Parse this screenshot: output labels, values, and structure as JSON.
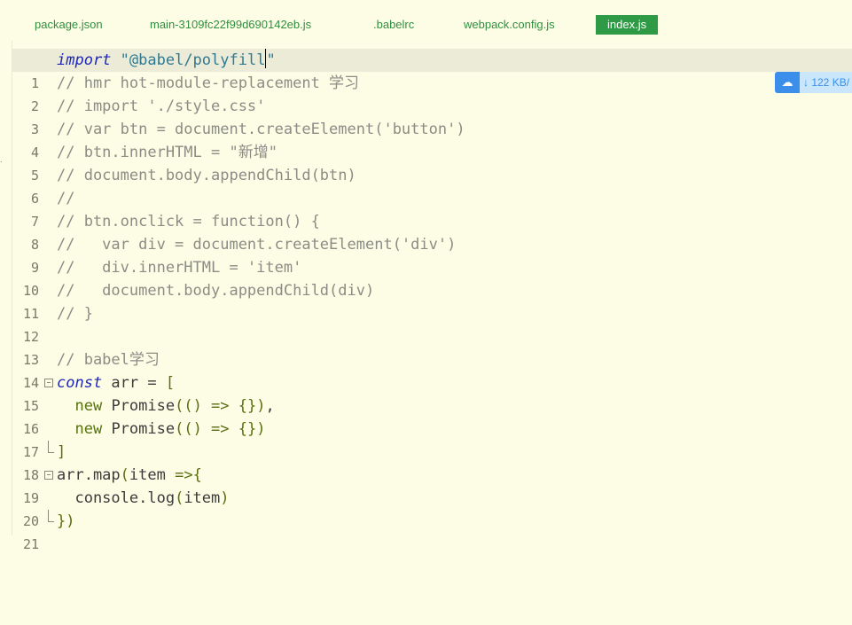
{
  "tabs": [
    {
      "label": "package.json"
    },
    {
      "label": "main-3109fc22f99d690142eb.js"
    },
    {
      "label": ".babelrc"
    },
    {
      "label": "webpack.config.js"
    },
    {
      "label": "index.js",
      "active": true
    }
  ],
  "badge": {
    "icon": "cloud-download-icon",
    "text": "↓ 122 KB/"
  },
  "code": {
    "lines": [
      {
        "n": "1",
        "t": [
          "import",
          " ",
          "\"@babel/polyfill",
          "\""
        ]
      },
      {
        "n": "2",
        "t": [
          "// hmr hot-module-replacement 学习"
        ]
      },
      {
        "n": "3",
        "t": [
          "// import './style.css'"
        ]
      },
      {
        "n": "4",
        "t": [
          "// var btn = document.createElement('button')"
        ]
      },
      {
        "n": "5",
        "t": [
          "// btn.innerHTML = \"新增\""
        ]
      },
      {
        "n": "6",
        "t": [
          "// document.body.appendChild(btn)"
        ]
      },
      {
        "n": "7",
        "t": [
          "//"
        ]
      },
      {
        "n": "8",
        "t": [
          "// btn.onclick = function() {"
        ]
      },
      {
        "n": "9",
        "t": [
          "//   var div = document.createElement('div')"
        ]
      },
      {
        "n": "10",
        "t": [
          "//   div.innerHTML = 'item'"
        ]
      },
      {
        "n": "11",
        "t": [
          "//   document.body.appendChild(div)"
        ]
      },
      {
        "n": "12",
        "t": [
          "// }"
        ]
      },
      {
        "n": "13",
        "t": []
      },
      {
        "n": "14",
        "t": [
          "// babel学习"
        ]
      },
      {
        "n": "15",
        "t": [
          "const",
          " arr ",
          "=",
          " ",
          "["
        ]
      },
      {
        "n": "16",
        "t": [
          "  ",
          "new",
          " Promise",
          "(()",
          " => ",
          "{})",
          ","
        ]
      },
      {
        "n": "17",
        "t": [
          "  ",
          "new",
          " Promise",
          "(()",
          " => ",
          "{})"
        ]
      },
      {
        "n": "18",
        "t": [
          "]"
        ]
      },
      {
        "n": "19",
        "t": [
          "arr.map",
          "(",
          "item ",
          "=>{"
        ]
      },
      {
        "n": "20",
        "t": [
          "  console.log",
          "(",
          "item",
          ")"
        ]
      },
      {
        "n": "21",
        "t": [
          "})"
        ]
      }
    ]
  }
}
